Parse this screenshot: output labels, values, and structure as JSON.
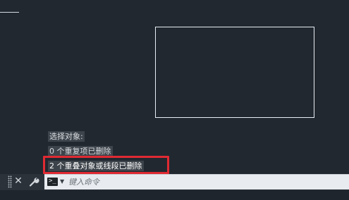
{
  "history": {
    "lines": [
      "选择对象:",
      "0 个重复项已删除",
      "2 个重叠对象或线段已删除"
    ]
  },
  "command": {
    "placeholder": "键入命令",
    "prompt_symbol": ">_"
  },
  "icons": {
    "grip": "grip-icon",
    "close": "close-icon",
    "customize": "wrench-icon",
    "prompt": "command-prompt-icon",
    "dropdown": "chevron-down-icon"
  },
  "colors": {
    "canvas": "#212830",
    "highlight_frame": "#e02a33"
  }
}
